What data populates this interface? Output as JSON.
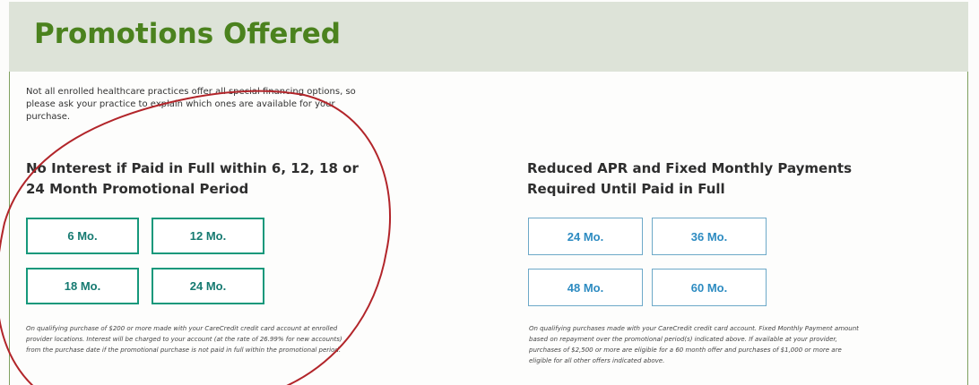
{
  "header": {
    "title": "Promotions Offered"
  },
  "intro": {
    "text": "Not all enrolled healthcare practices offer all special financing options, so please ask your practice to explain which ones are available for your purchase."
  },
  "sections": {
    "no_interest": {
      "title": "No Interest if Paid in Full within 6, 12, 18 or 24 Month Promotional Period",
      "buttons": [
        "6 Mo.",
        "12 Mo.",
        "18 Mo.",
        "24 Mo."
      ],
      "fineprint": "On qualifying purchase of $200 or more made with your CareCredit credit card account at enrolled provider locations. Interest will be charged to your account (at the rate of 26.99% for new accounts) from the purchase date if the promotional purchase is not paid in full within the promotional period."
    },
    "reduced_apr": {
      "title": "Reduced APR and Fixed Monthly Payments Required Until Paid in Full",
      "buttons": [
        "24 Mo.",
        "36 Mo.",
        "48 Mo.",
        "60 Mo."
      ],
      "fineprint": "On qualifying purchases made with your CareCredit credit card account. Fixed Monthly Payment amount based on repayment over the promotional period(s) indicated above. If available at your provider, purchases of $2,500 or more are eligible for a 60 month offer and purchases of $1,000 or more are eligible for all other offers indicated above."
    }
  },
  "colors": {
    "header_bg": "#dde3d8",
    "title_green": "#4b821e",
    "teal": "#15987b",
    "blue": "#2d8bc1",
    "annotation_red": "#b2252a"
  }
}
